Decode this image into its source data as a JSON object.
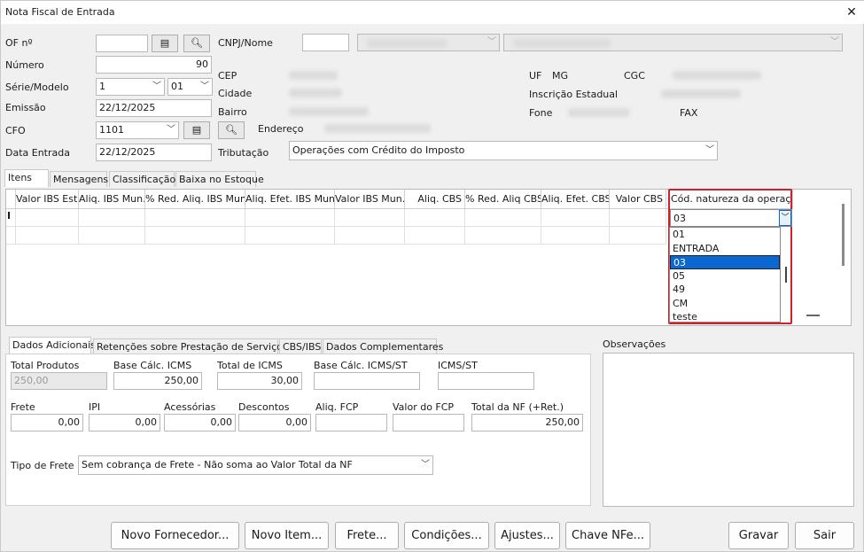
{
  "window": {
    "title": "Nota Fiscal de Entrada",
    "close": "✕"
  },
  "header": {
    "of_label": "OF nº",
    "of_value": "",
    "numero_label": "Número",
    "numero_value": "90",
    "serie_label": "Série/Modelo",
    "serie_value": "1",
    "modelo_value": "01",
    "emissao_label": "Emissão",
    "emissao_value": "22/12/2025",
    "cfo_label": "CFO",
    "cfo_value": "1101",
    "data_entrada_label": "Data Entrada",
    "data_entrada_value": "22/12/2025",
    "cnpj_label": "CNPJ/Nome",
    "cep_label": "CEP",
    "cidade_label": "Cidade",
    "bairro_label": "Bairro",
    "endereco_label": "Endereço",
    "uf_label": "UF",
    "uf_value": "MG",
    "cgc_label": "CGC",
    "ie_label": "Inscrição Estadual",
    "fone_label": "Fone",
    "fax_label": "FAX",
    "tributacao_label": "Tributação",
    "tributacao_value": "Operações com Crédito do Imposto"
  },
  "tabs_top": [
    "Itens",
    "Mensagens",
    "Classificação",
    "Baixa no Estoque"
  ],
  "grid": {
    "columns": [
      "Valor IBS Est.",
      "Aliq. IBS Mun.",
      "% Red. Aliq. IBS Mun.",
      "Aliq. Efet. IBS Mun.",
      "Valor IBS Mun.",
      "Aliq. CBS",
      "% Red. Aliq CBS",
      "Aliq. Efet. CBS",
      "Valor CBS",
      "Cód. natureza da operação"
    ],
    "row_indicator": "I",
    "natureza_value": "03",
    "dropdown_options": [
      "01",
      "ENTRADA",
      "03",
      "05",
      "49",
      "CM",
      "teste"
    ],
    "dropdown_selected": "03"
  },
  "tabs_bottom": [
    "Dados Adicionais",
    "Retenções sobre Prestação de Serviços",
    "CBS/IBS",
    "Dados Complementares"
  ],
  "observacoes_label": "Observações",
  "totals": {
    "total_produtos_label": "Total Produtos",
    "total_produtos_value": "250,00",
    "base_icms_label": "Base Cálc. ICMS",
    "base_icms_value": "250,00",
    "total_icms_label": "Total de ICMS",
    "total_icms_value": "30,00",
    "base_icms_st_label": "Base Cálc. ICMS/ST",
    "base_icms_st_value": "",
    "icms_st_label": "ICMS/ST",
    "icms_st_value": "",
    "frete_label": "Frete",
    "frete_value": "0,00",
    "ipi_label": "IPI",
    "ipi_value": "0,00",
    "acessorias_label": "Acessórias",
    "acessorias_value": "0,00",
    "descontos_label": "Descontos",
    "descontos_value": "0,00",
    "aliq_fcp_label": "Aliq. FCP",
    "aliq_fcp_value": "",
    "valor_fcp_label": "Valor do FCP",
    "valor_fcp_value": "",
    "total_nf_label": "Total da NF (+Ret.)",
    "total_nf_value": "250,00",
    "tipo_frete_label": "Tipo de Frete",
    "tipo_frete_value": "Sem cobrança de Frete - Não soma ao Valor Total da NF"
  },
  "buttons": [
    "Novo Fornecedor...",
    "Novo Item...",
    "Frete...",
    "Condições...",
    "Ajustes...",
    "Chave NFe...",
    "Gravar",
    "Sair"
  ],
  "colors": {
    "selection": "#0b68d2",
    "highlight_border": "#d0202a"
  }
}
